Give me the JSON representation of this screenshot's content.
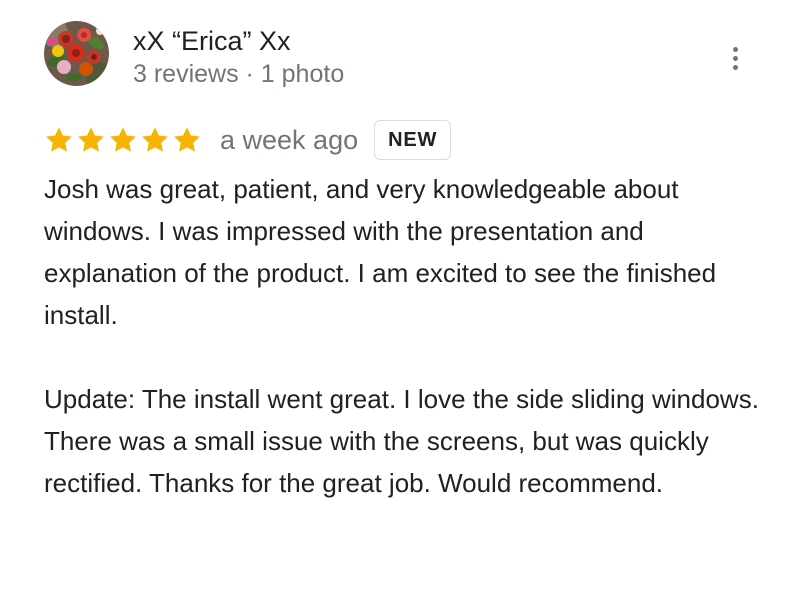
{
  "reviewer": {
    "name": "xX “Erica” Xx",
    "meta": "3 reviews · 1 photo",
    "avatar_icon": "rose-bouquet-avatar"
  },
  "menu": {
    "icon": "more-vert-icon"
  },
  "rating": {
    "stars": 5,
    "max": 5,
    "star_color": "#f4b400",
    "time_ago": "a week ago",
    "badge": "NEW"
  },
  "review": {
    "paragraph_1": "Josh was great, patient, and very knowledgeable about windows. I was impressed with the presentation and explanation of the product. I am excited to see the finished install.",
    "paragraph_2": "Update: The install went great. I love the side sliding windows. There was a small issue with the screens, but was quickly rectified. Thanks for the great job. Would recommend."
  },
  "colors": {
    "text_primary": "#202124",
    "text_secondary": "#70757a",
    "badge_border": "#dadce0"
  }
}
